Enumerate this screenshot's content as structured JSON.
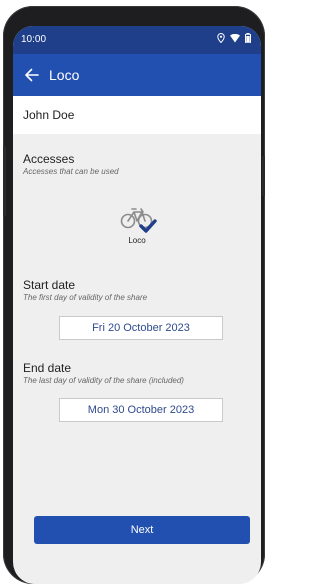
{
  "status": {
    "time": "10:00"
  },
  "appbar": {
    "title": "Loco"
  },
  "user": {
    "name": "John Doe"
  },
  "accesses": {
    "title": "Accesses",
    "subtitle": "Accesses that can be used",
    "items": [
      {
        "label": "Loco",
        "icon": "bike-icon",
        "selected": true
      }
    ]
  },
  "start_date": {
    "title": "Start date",
    "subtitle": "The first day of validity of the share",
    "value": "Fri 20 October 2023"
  },
  "end_date": {
    "title": "End date",
    "subtitle": "The last day of validity of the share (included)",
    "value": "Mon 30 October 2023"
  },
  "actions": {
    "next_label": "Next"
  },
  "colors": {
    "primary": "#2250b0",
    "status_bar": "#1f3f8a",
    "date_text": "#2f4a8f",
    "background": "#efefef"
  }
}
